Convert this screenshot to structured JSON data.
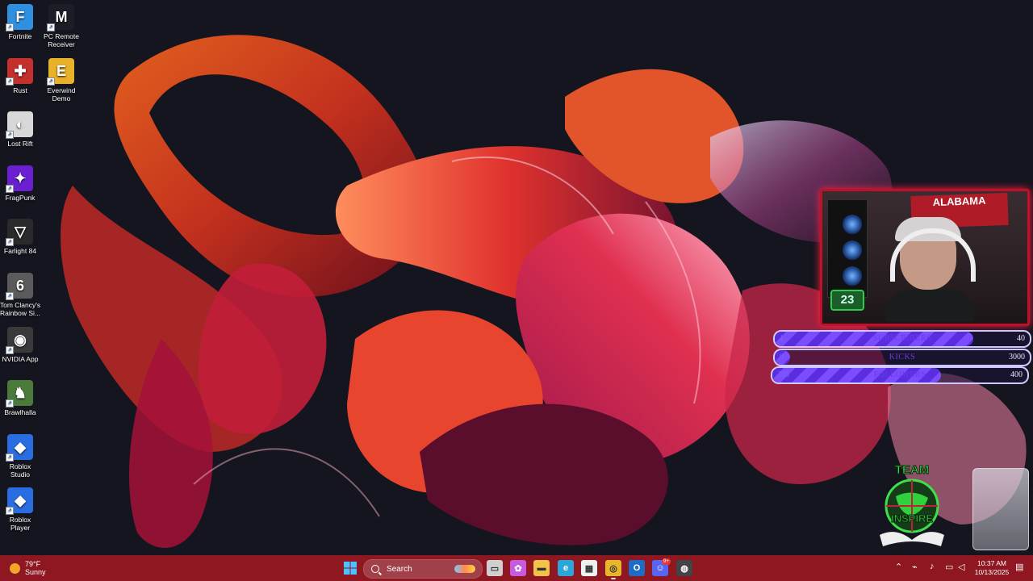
{
  "desktop": {
    "icons_left": [
      {
        "label": "Fortnite",
        "icon": "fortnite-icon",
        "color": "#2f8fe0",
        "glyph": "F"
      },
      {
        "label": "Rust",
        "icon": "rust-icon",
        "color": "#c4302b",
        "glyph": "✚"
      },
      {
        "label": "Lost Rift",
        "icon": "lost-rift-icon",
        "color": "#d8d8d8",
        "glyph": "◐"
      },
      {
        "label": "FragPunk",
        "icon": "fragpunk-icon",
        "color": "#6a1fd0",
        "glyph": "✦"
      },
      {
        "label": "Farlight 84",
        "icon": "farlight-84-icon",
        "color": "#2a2a2a",
        "glyph": "▽"
      },
      {
        "label": "Tom Clancy's Rainbow Si...",
        "icon": "rainbow-six-icon",
        "color": "#5b5b5b",
        "glyph": "6"
      },
      {
        "label": "NVIDIA App",
        "icon": "nvidia-app-icon",
        "color": "#3a3a3a",
        "glyph": "◉"
      },
      {
        "label": "Brawlhalla",
        "icon": "brawlhalla-icon",
        "color": "#4c7a3a",
        "glyph": "♞"
      },
      {
        "label": "Roblox Studio",
        "icon": "roblox-studio-icon",
        "color": "#2a6de0",
        "glyph": "◆"
      },
      {
        "label": "Roblox Player",
        "icon": "roblox-player-icon",
        "color": "#2a6de0",
        "glyph": "◆"
      }
    ],
    "icons_right": [
      {
        "label": "PC Remote Receiver",
        "icon": "pc-remote-receiver-icon",
        "color": "#1c1d26",
        "glyph": "M"
      },
      {
        "label": "Everwind Demo",
        "icon": "everwind-demo-icon",
        "color": "#e8b12a",
        "glyph": "E"
      }
    ]
  },
  "overlay": {
    "webcam": {
      "sign_text": "ALABAMA",
      "counter": "23"
    },
    "goals": [
      {
        "current": "1",
        "label": "SUBSCRIBERS",
        "target": "40",
        "fill": 0.78
      },
      {
        "current": "0",
        "label": "KICKS",
        "target": "3000",
        "fill": 0.06
      },
      {
        "current": "366",
        "label": "FOLLOWERS",
        "target": "400",
        "fill": 0.66
      }
    ],
    "team_logo_top": "TEAM",
    "team_logo_bottom": "INSPIRE"
  },
  "taskbar": {
    "weather": {
      "temp": "79°F",
      "condition": "Sunny"
    },
    "search_label": "Search",
    "pinned": [
      {
        "icon": "task-view-icon",
        "color": "#d0d0d0",
        "glyph": "▭"
      },
      {
        "icon": "copilot-icon",
        "color": "#c85ae0",
        "glyph": "✿"
      },
      {
        "icon": "file-explorer-icon",
        "color": "#f2c24a",
        "glyph": "▬"
      },
      {
        "icon": "edge-icon",
        "color": "#2aa6d8",
        "glyph": "e"
      },
      {
        "icon": "microsoft-store-icon",
        "color": "#f0f0f0",
        "glyph": "▦"
      },
      {
        "icon": "chrome-icon",
        "color": "#e8b62a",
        "glyph": "◎"
      },
      {
        "icon": "outlook-icon",
        "color": "#1f6bc8",
        "glyph": "O"
      },
      {
        "icon": "discord-icon",
        "color": "#5865f2",
        "glyph": "☺"
      },
      {
        "icon": "obs-icon",
        "color": "#444444",
        "glyph": "◍"
      }
    ],
    "discord_badge": "9+",
    "clock": {
      "time": "10:37 AM",
      "date": "10/13/2025"
    }
  }
}
